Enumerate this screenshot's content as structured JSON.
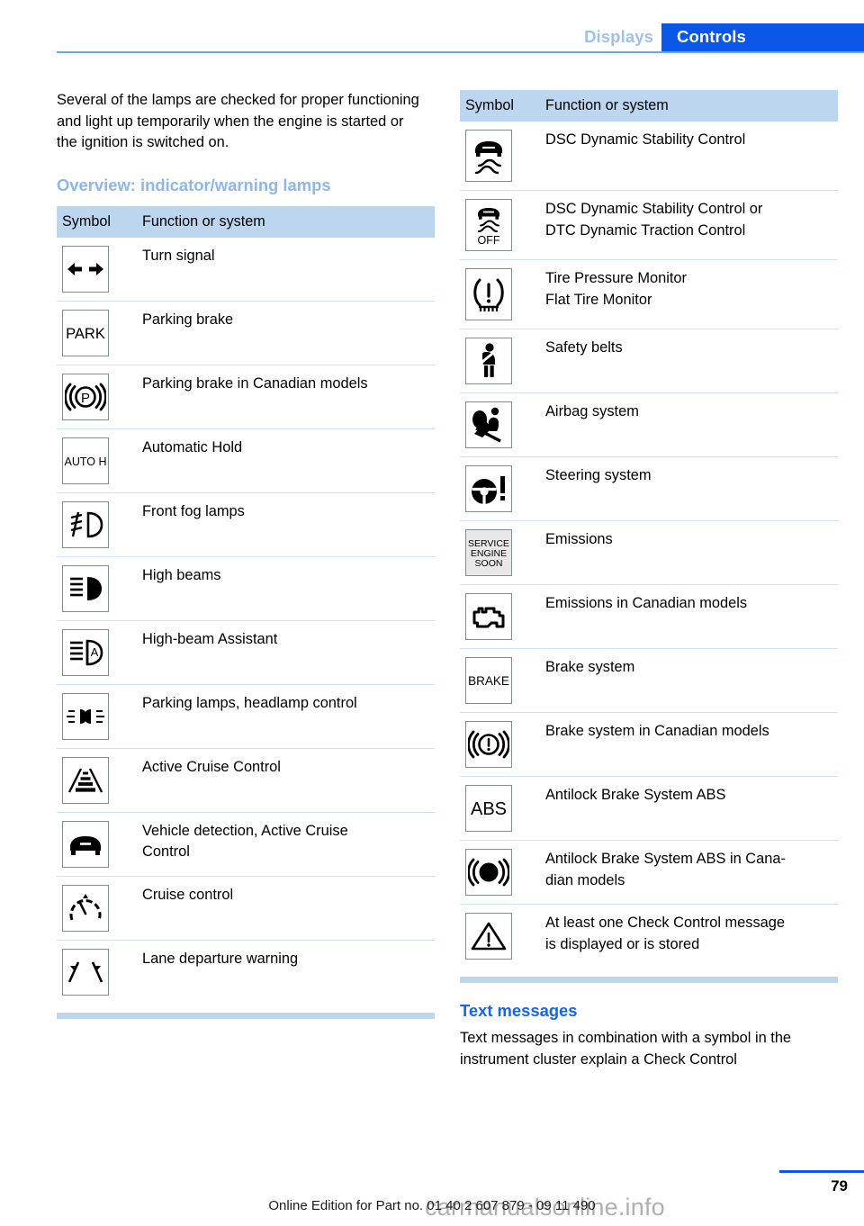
{
  "header": {
    "tab_inactive": "Displays",
    "tab_active": "Controls"
  },
  "left_column": {
    "intro_paragraph": "Several of the lamps are checked for proper functioning and light up temporarily when the engine is started or the ignition is switched on.",
    "section_heading": "Overview: indicator/warning lamps",
    "table": {
      "columns": [
        "Symbol",
        "Function or system"
      ],
      "rows": [
        {
          "icon": "turn-signal-icon",
          "text": "Turn signal",
          "text2": ""
        },
        {
          "icon": "park-brake-icon",
          "text": "Parking brake",
          "text2": ""
        },
        {
          "icon": "park-brake-canadian-icon",
          "text": "Parking brake in Canadian models",
          "text2": ""
        },
        {
          "icon": "auto-hold-icon",
          "text": "Automatic Hold",
          "text2": ""
        },
        {
          "icon": "front-fog-lamp-icon",
          "text": "Front fog lamps",
          "text2": ""
        },
        {
          "icon": "high-beam-icon",
          "text": "High beams",
          "text2": ""
        },
        {
          "icon": "high-beam-assistant-icon",
          "text": "High-beam Assistant",
          "text2": ""
        },
        {
          "icon": "parking-lamp-icon",
          "text": "Parking lamps, headlamp control",
          "text2": ""
        },
        {
          "icon": "active-cruise-control-icon",
          "text": "Active Cruise Control",
          "text2": ""
        },
        {
          "icon": "vehicle-detection-icon",
          "text": "Vehicle detection, Active Cruise",
          "text2": "Control"
        },
        {
          "icon": "cruise-control-icon",
          "text": "Cruise control",
          "text2": ""
        },
        {
          "icon": "lane-departure-icon",
          "text": "Lane departure warning",
          "text2": ""
        }
      ]
    }
  },
  "right_column": {
    "table": {
      "columns": [
        "Symbol",
        "Function or system"
      ],
      "rows": [
        {
          "icon": "dsc-icon",
          "text": "DSC Dynamic Stability Control",
          "text2": ""
        },
        {
          "icon": "dsc-off-icon",
          "text": "DSC Dynamic Stability Control or",
          "text2": "DTC Dynamic Traction Control"
        },
        {
          "icon": "tire-pressure-icon",
          "text": "Tire Pressure Monitor",
          "text2": "Flat Tire Monitor"
        },
        {
          "icon": "safety-belt-icon",
          "text": "Safety belts",
          "text2": ""
        },
        {
          "icon": "airbag-icon",
          "text": "Airbag system",
          "text2": ""
        },
        {
          "icon": "steering-system-icon",
          "text": "Steering system",
          "text2": ""
        },
        {
          "icon": "service-engine-soon-icon",
          "text": "Emissions",
          "text2": ""
        },
        {
          "icon": "check-engine-icon",
          "text": "Emissions in Canadian models",
          "text2": ""
        },
        {
          "icon": "brake-text-icon",
          "text": "Brake system",
          "text2": ""
        },
        {
          "icon": "brake-canadian-icon",
          "text": "Brake system in Canadian models",
          "text2": ""
        },
        {
          "icon": "abs-icon",
          "text": "Antilock Brake System ABS",
          "text2": ""
        },
        {
          "icon": "abs-canadian-icon",
          "text": "Antilock Brake System ABS in Cana-",
          "text2": "dian models"
        },
        {
          "icon": "check-control-icon",
          "text": "At least one Check Control message",
          "text2": "is displayed or is stored"
        }
      ]
    },
    "section_heading": "Text messages",
    "body_paragraph": "Text messages in combination with a symbol in the instrument cluster explain a Check Control"
  },
  "footer": {
    "edition_line": "Online Edition for Part no. 01 40 2 607 879 - 09 11 490",
    "page_number": "79",
    "watermark": "carmanualsonline.info"
  },
  "icon_labels": {
    "park": "PARK",
    "auto_h": "AUTO H",
    "high_beam_assist": "A",
    "off": "OFF",
    "service": "SERVICE",
    "engine": "ENGINE",
    "soon": "SOON",
    "brake": "BRAKE",
    "abs": "ABS",
    "abs_small": "ABS",
    "p": "P"
  },
  "colors": {
    "accent_blue": "#0a56e8",
    "light_blue": "#8cb6ec",
    "table_header_bg": "#bcd6f0",
    "row_divider": "#cfe2f7"
  }
}
